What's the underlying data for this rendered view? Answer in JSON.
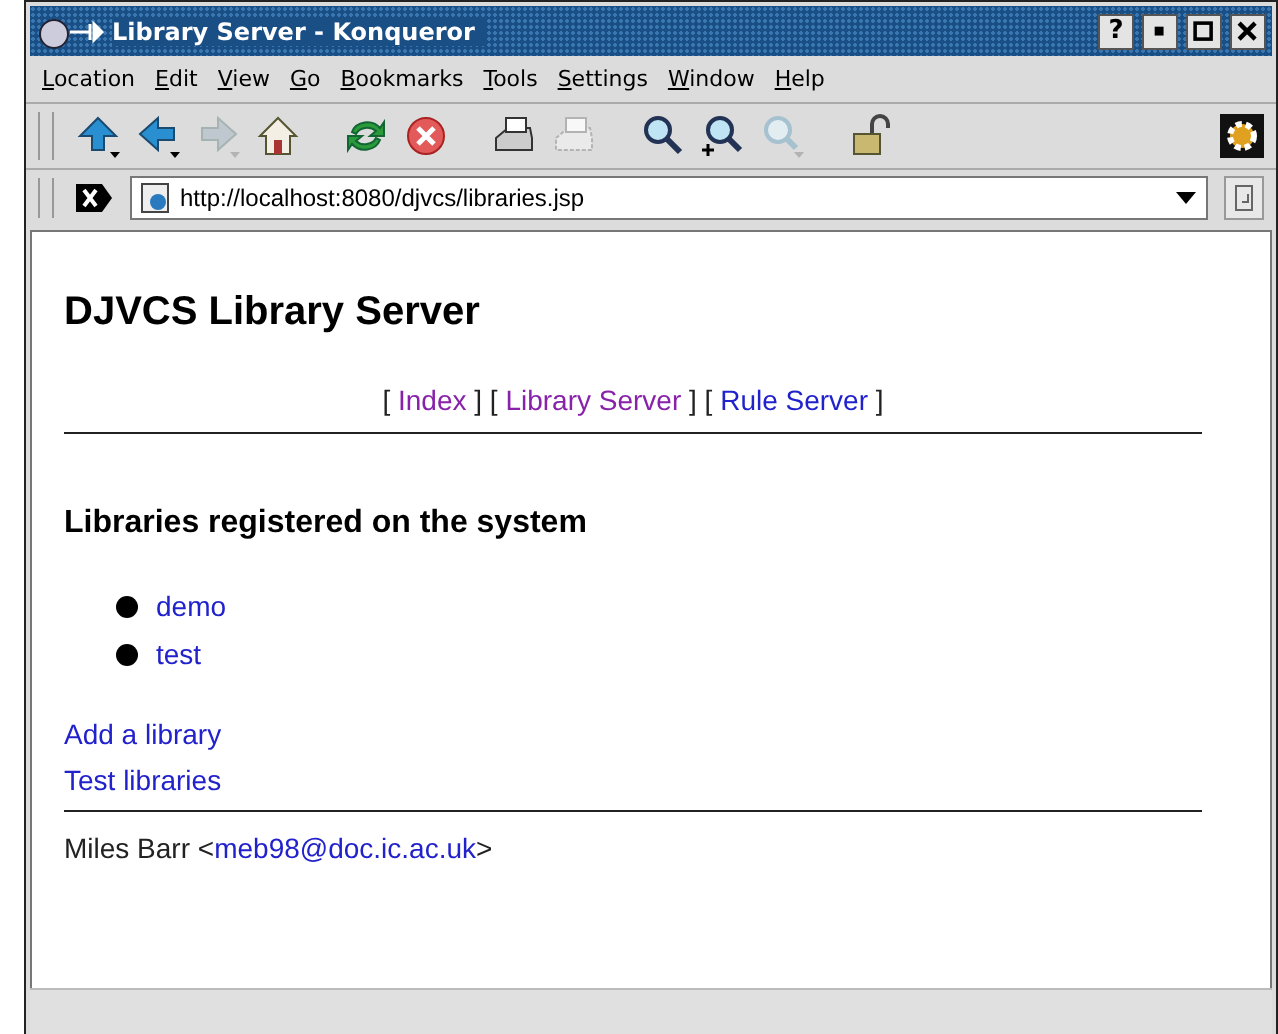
{
  "window": {
    "title": "Library Server - Konqueror",
    "help_button": "?"
  },
  "menu": [
    "Location",
    "Edit",
    "View",
    "Go",
    "Bookmarks",
    "Tools",
    "Settings",
    "Window",
    "Help"
  ],
  "toolbar": [
    {
      "kind": "up",
      "disabled": false
    },
    {
      "kind": "back",
      "disabled": false
    },
    {
      "kind": "forward",
      "disabled": true
    },
    {
      "kind": "home",
      "disabled": false
    },
    {
      "kind": "reload",
      "disabled": false
    },
    {
      "kind": "stop",
      "disabled": false
    },
    {
      "kind": "print",
      "disabled": false
    },
    {
      "kind": "preview",
      "disabled": true
    },
    {
      "kind": "zoom",
      "disabled": false
    },
    {
      "kind": "zoom-in",
      "disabled": false
    },
    {
      "kind": "zoom-out",
      "disabled": true
    },
    {
      "kind": "lock",
      "disabled": false
    }
  ],
  "location": {
    "url": "http://localhost:8080/djvcs/libraries.jsp"
  },
  "page": {
    "heading": "DJVCS Library Server",
    "nav": [
      {
        "before": "[",
        "label": "Index",
        "after": "]",
        "visited": true
      },
      {
        "before": "[",
        "label": "Library Server",
        "after": "]",
        "visited": true
      },
      {
        "before": "[",
        "label": "Rule Server",
        "after": "]",
        "visited": false
      }
    ],
    "subheading": "Libraries registered on the system",
    "libraries": [
      "demo",
      "test"
    ],
    "links": [
      "Add a library",
      "Test libraries"
    ],
    "footer": {
      "before": "Miles Barr <",
      "email": "meb98@doc.ic.ac.uk",
      "after": ">"
    }
  }
}
